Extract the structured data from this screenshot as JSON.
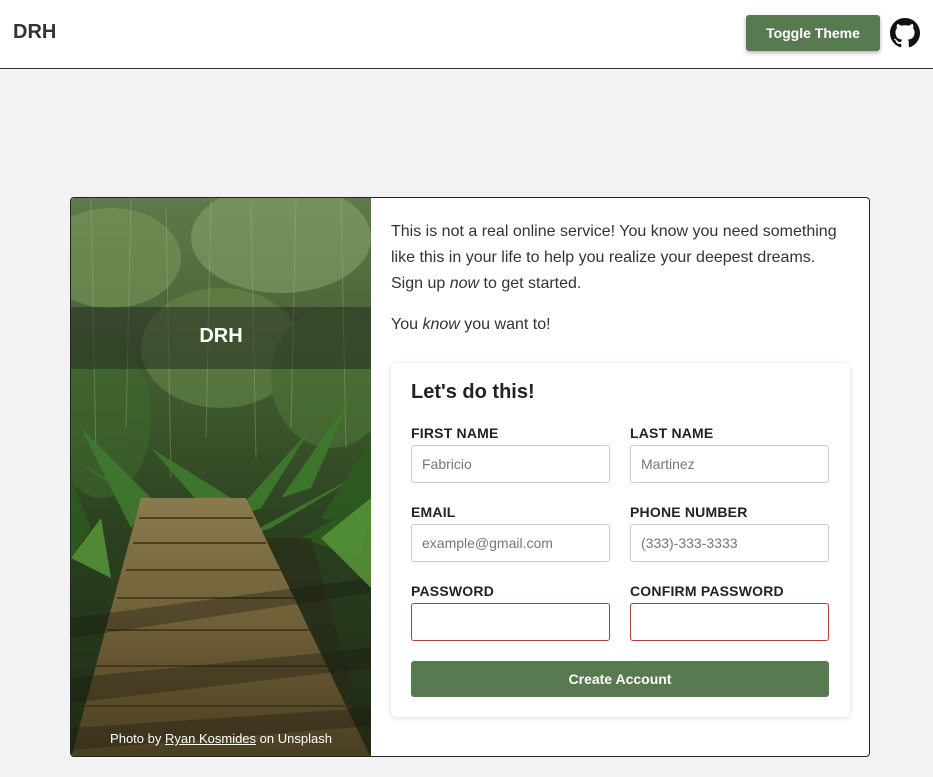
{
  "header": {
    "brand": "DRH",
    "toggle_label": "Toggle Theme",
    "github_icon": "github-icon"
  },
  "photo": {
    "title": "DRH",
    "credit_prefix": "Photo by",
    "credit_author": "Ryan Kosmides",
    "credit_suffix": "on Unsplash"
  },
  "intro": {
    "line1_before": "This is not a real online service! You know you need something like this in your life to help you realize your deepest dreams. Sign up",
    "line1_em": "now",
    "line1_after": "to get started.",
    "line2_before": "You",
    "line2_em": "know",
    "line2_after": "you want to!"
  },
  "form": {
    "title": "Let's do this!",
    "first_name": {
      "label": "FIRST NAME",
      "placeholder": "Fabricio",
      "value": ""
    },
    "last_name": {
      "label": "LAST NAME",
      "placeholder": "Martinez",
      "value": ""
    },
    "email": {
      "label": "EMAIL",
      "placeholder": "example@gmail.com",
      "value": ""
    },
    "phone": {
      "label": "PHONE NUMBER",
      "placeholder": "(333)-333-3333",
      "value": ""
    },
    "password": {
      "label": "PASSWORD",
      "placeholder": "",
      "value": ""
    },
    "confirm_password": {
      "label": "CONFIRM PASSWORD",
      "placeholder": "",
      "value": ""
    },
    "submit_label": "Create Account"
  },
  "colors": {
    "accent": "#587a51",
    "error_border": "#b43a3a"
  }
}
